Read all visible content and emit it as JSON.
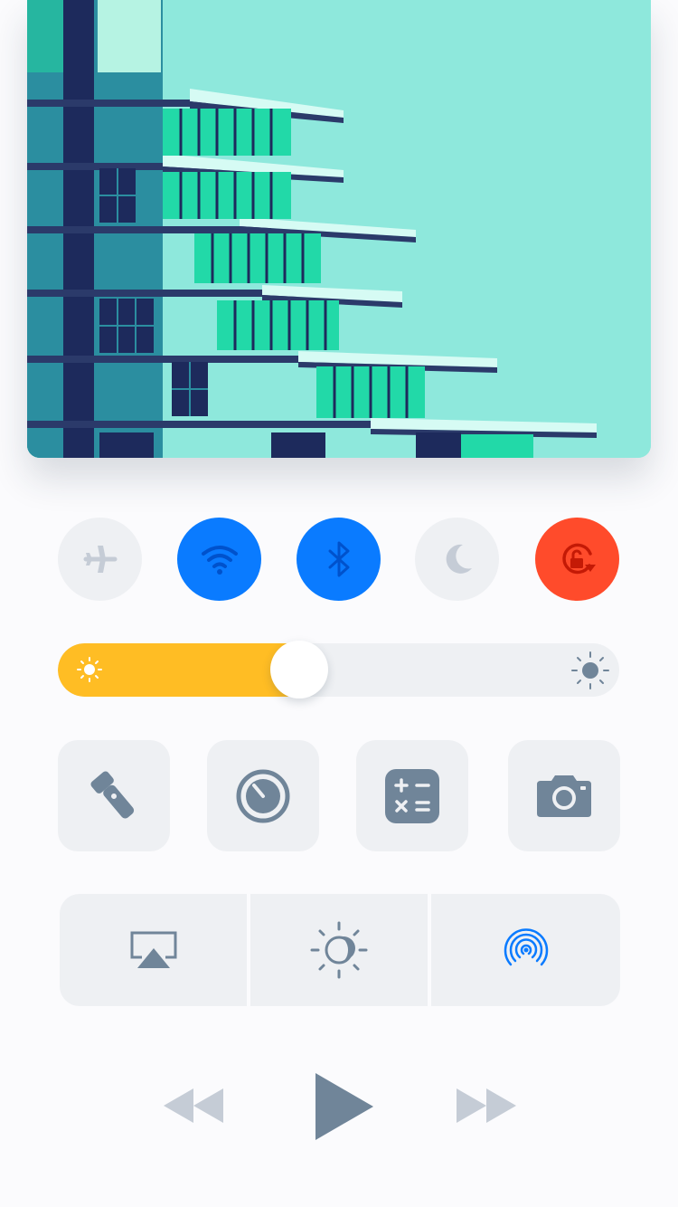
{
  "artwork": {
    "description_icon": "album-artwork-building-illustration"
  },
  "toggles": [
    {
      "name": "airplane-mode",
      "icon": "airplane-icon",
      "active": false
    },
    {
      "name": "wifi",
      "icon": "wifi-icon",
      "active": true
    },
    {
      "name": "bluetooth",
      "icon": "bluetooth-icon",
      "active": true
    },
    {
      "name": "do-not-disturb",
      "icon": "moon-icon",
      "active": false
    },
    {
      "name": "rotation-lock",
      "icon": "rotation-lock-icon",
      "active": true
    }
  ],
  "brightness": {
    "level": 0.43,
    "low_icon": "sun-small-icon",
    "high_icon": "sun-large-icon"
  },
  "shortcuts": [
    {
      "name": "flashlight",
      "icon": "flashlight-icon"
    },
    {
      "name": "timer",
      "icon": "timer-icon"
    },
    {
      "name": "calculator",
      "icon": "calculator-icon"
    },
    {
      "name": "camera",
      "icon": "camera-icon"
    }
  ],
  "segments": [
    {
      "name": "airplay",
      "icon": "airplay-icon"
    },
    {
      "name": "night-shift",
      "icon": "night-shift-icon"
    },
    {
      "name": "airdrop",
      "icon": "airdrop-icon"
    }
  ],
  "media": {
    "previous_icon": "rewind-icon",
    "play_icon": "play-icon",
    "next_icon": "fast-forward-icon"
  },
  "colors": {
    "accent_blue": "#0a7bff",
    "rotation_red": "#ff4b2b",
    "brightness_fill": "#ffbd24",
    "inactive_bg": "#eef0f3",
    "icon_gray": "#708599",
    "icon_light_gray": "#c5ccd6",
    "page_bg": "#fbfbfd"
  }
}
